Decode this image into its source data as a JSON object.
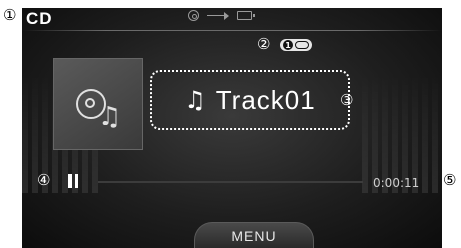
{
  "header": {
    "title": "CD",
    "status_icons": [
      "disc-icon",
      "usb-icon",
      "card-icon"
    ]
  },
  "callouts": [
    "①",
    "②",
    "③",
    "④",
    "⑤"
  ],
  "playback": {
    "repeat_badge_label": "1",
    "repeat_mode": "repeat-one",
    "track_name": "Track01",
    "state": "paused",
    "elapsed": "0:00:11",
    "progress": 0.0
  },
  "footer": {
    "menu_label": "MENU"
  },
  "colors": {
    "screen_bg": "#1e1e1e",
    "text": "#ffffff",
    "muted": "#9a9a9a"
  }
}
